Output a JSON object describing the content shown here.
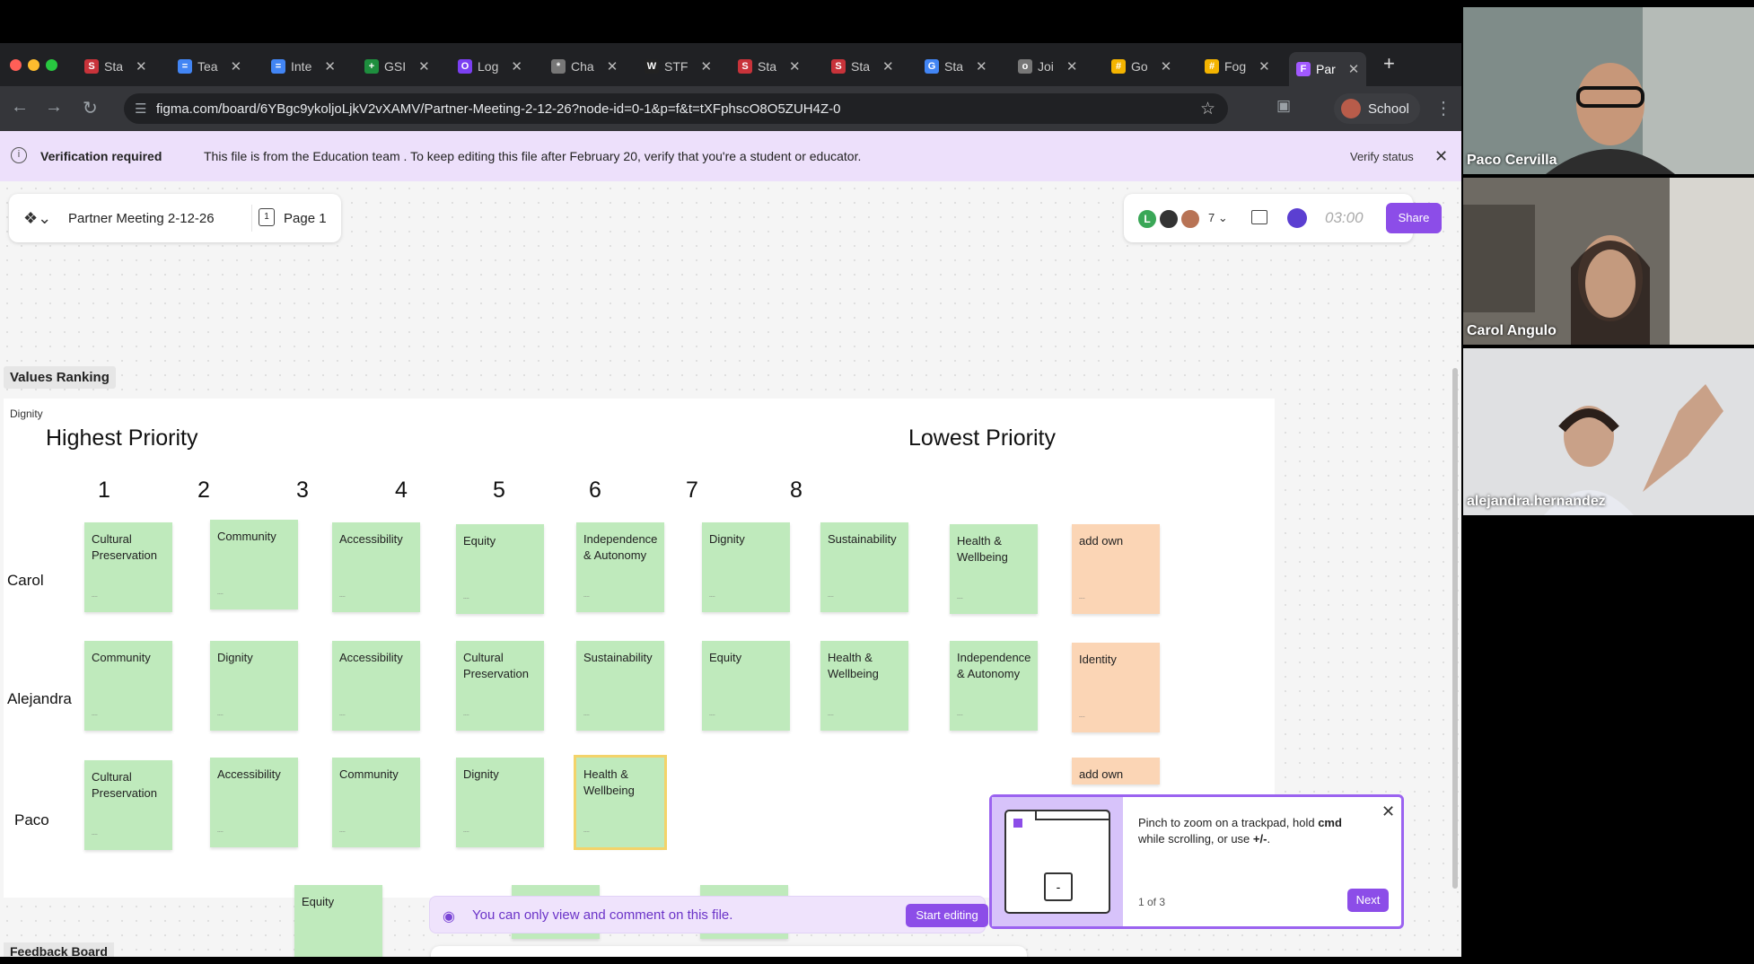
{
  "browser": {
    "tabs": [
      {
        "label": "Sta",
        "icon": "S",
        "color": "#c8333a"
      },
      {
        "label": "Tea",
        "icon": "=",
        "color": "#4285f4"
      },
      {
        "label": "Inte",
        "icon": "=",
        "color": "#4285f4"
      },
      {
        "label": "GSI",
        "icon": "+",
        "color": "#1e8e3e"
      },
      {
        "label": "Log",
        "icon": "O",
        "color": "#7b3ff2"
      },
      {
        "label": "Cha",
        "icon": "*",
        "color": "#777777"
      },
      {
        "label": "STF",
        "icon": "W",
        "color": "#222222"
      },
      {
        "label": "Sta",
        "icon": "S",
        "color": "#c8333a"
      },
      {
        "label": "Sta",
        "icon": "S",
        "color": "#c8333a"
      },
      {
        "label": "Sta",
        "icon": "G",
        "color": "#4285f4"
      },
      {
        "label": "Joi",
        "icon": "o",
        "color": "#777777"
      },
      {
        "label": "Go",
        "icon": "#",
        "color": "#f4b400"
      },
      {
        "label": "Fog",
        "icon": "#",
        "color": "#f4b400"
      },
      {
        "label": "Par",
        "icon": "F",
        "color": "#a259ff"
      }
    ],
    "url": "figma.com/board/6YBgc9ykoljoLjkV2vXAMV/Partner-Meeting-2-12-26?node-id=0-1&p=f&t=tXFphscO8O5ZUH4Z-0",
    "profile_label": "School"
  },
  "banner": {
    "title": "Verification required",
    "message": "This file is from the Education team . To keep editing this file after February 20, verify that you're a student or educator.",
    "verify_label": "Verify status"
  },
  "file": {
    "name": "Partner Meeting 2-12-26",
    "page": "Page 1"
  },
  "collab": {
    "first_avatar": "L",
    "count": "7",
    "timer": "03:00",
    "share_label": "Share"
  },
  "board": {
    "section_label": "Values Ranking",
    "sublabel": "Dignity",
    "highest_label": "Highest Priority",
    "lowest_label": "Lowest Priority",
    "columns": [
      "1",
      "2",
      "3",
      "4",
      "5",
      "6",
      "7",
      "8"
    ],
    "rows": [
      {
        "name": "Carol",
        "items": [
          "Cultural Preservation",
          "Community",
          "Accessibility",
          "Equity",
          "Independence & Autonomy",
          "Dignity",
          "Sustainability",
          "Health & Wellbeing",
          "add own"
        ]
      },
      {
        "name": "Alejandra",
        "items": [
          "Community",
          "Dignity",
          "Accessibility",
          "Cultural Preservation",
          "Sustainability",
          "Equity",
          "Health & Wellbeing",
          "Independence & Autonomy",
          "Identity"
        ]
      },
      {
        "name": "Paco",
        "items": [
          "Cultural Preservation",
          "Accessibility",
          "Community",
          "Dignity",
          "Health & Wellbeing",
          "add own"
        ]
      }
    ],
    "outside_sticky": "Equity",
    "feedback_label": "Feedback Board"
  },
  "viewbar": {
    "message": "You can only view and comment on this file.",
    "button": "Start editing"
  },
  "tip": {
    "text_before": "Pinch to zoom on a trackpad, hold ",
    "text_bold1": "cmd",
    "text_mid": " while scrolling, or use ",
    "text_bold2": "+/-",
    "text_after": ".",
    "step": "1 of 3",
    "next": "Next",
    "key": "-"
  },
  "toolbar": {
    "tools": [
      "cursor-icon",
      "hand-icon",
      "marker-icon",
      "washi-icon",
      "shape-icon",
      "connector-icon",
      "text-icon",
      "section-icon",
      "table-icon",
      "stamp-icon",
      "comment-icon",
      "more-tools-icon",
      "plus-icon"
    ]
  },
  "zoom": {
    "minus": "−",
    "plus": "+"
  },
  "help": "?",
  "participants": [
    {
      "name": "Paco Cervilla"
    },
    {
      "name": "Carol Angulo"
    },
    {
      "name": "alejandra.hernandez"
    }
  ]
}
